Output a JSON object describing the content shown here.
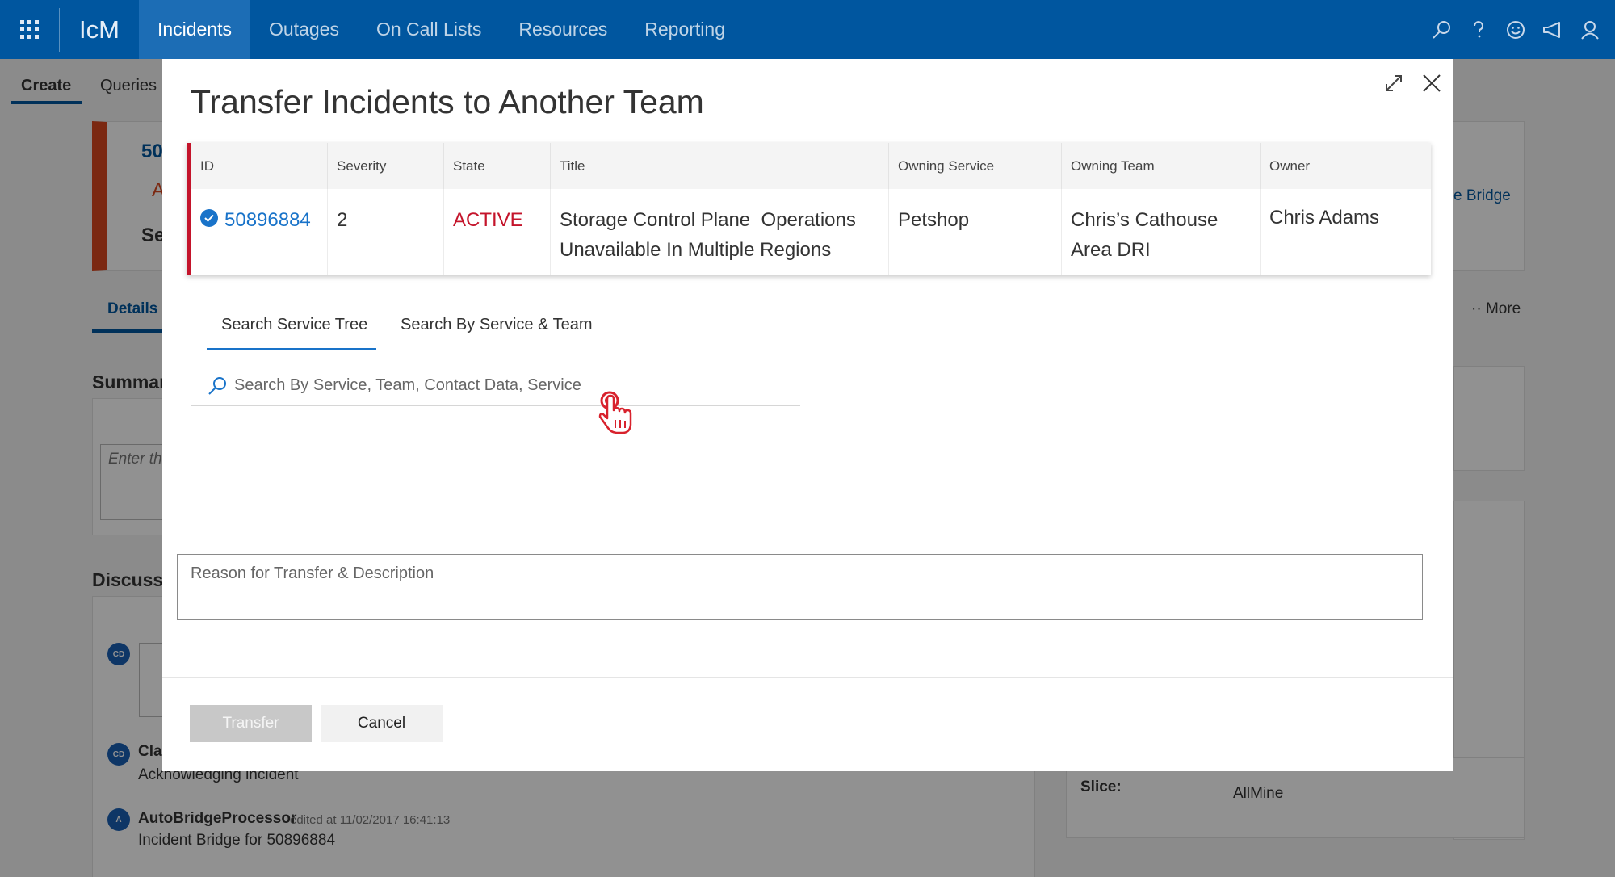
{
  "app": {
    "brand": "IcM"
  },
  "nav": [
    "Incidents",
    "Outages",
    "On Call Lists",
    "Resources",
    "Reporting"
  ],
  "subnav": {
    "create": "Create",
    "queries": "Queries"
  },
  "background": {
    "id_fragment": "50",
    "a_fragment": "A",
    "se_fragment": "Se",
    "bridge_label": "e Bridge",
    "details_tab": "Details",
    "more_label": "More",
    "summary_heading": "Summar",
    "summary_placeholder": "Enter th",
    "discussion_heading": "Discussi",
    "entries": [
      {
        "avatar": "CD",
        "author": "Cla",
        "text": "Acknowledging incident",
        "meta": ""
      },
      {
        "avatar": "A",
        "author": "AutoBridgeProcessor",
        "meta": "edited at 11/02/2017 16:41:13",
        "text": "Incident Bridge for 50896884"
      }
    ],
    "first_avatar": "CD",
    "slice_label": "Slice:",
    "slice_value": "AllMine"
  },
  "modal": {
    "title": "Transfer Incidents to Another Team",
    "table": {
      "headers": [
        "ID",
        "Severity",
        "State",
        "Title",
        "Owning Service",
        "Owning Team",
        "Owner"
      ],
      "row": {
        "id": "50896884",
        "severity": "2",
        "state": "ACTIVE",
        "title_line1": "Storage Control Plane  Operations",
        "title_line2": "Unavailable In Multiple Regions",
        "owning_service": "Petshop",
        "owning_team_line1": "Chris’s Cathouse",
        "owning_team_line2": "Area DRI",
        "owner": "Chris Adams"
      }
    },
    "tabs": [
      "Search Service Tree",
      "Search By Service & Team"
    ],
    "search_placeholder": "Search By Service, Team, Contact Data, Service",
    "reason_placeholder": "Reason for Transfer & Description",
    "buttons": {
      "transfer": "Transfer",
      "cancel": "Cancel"
    }
  },
  "colors": {
    "header_blue": "#00569f",
    "accent_blue": "#1973c9",
    "active_red": "#c4142b"
  }
}
